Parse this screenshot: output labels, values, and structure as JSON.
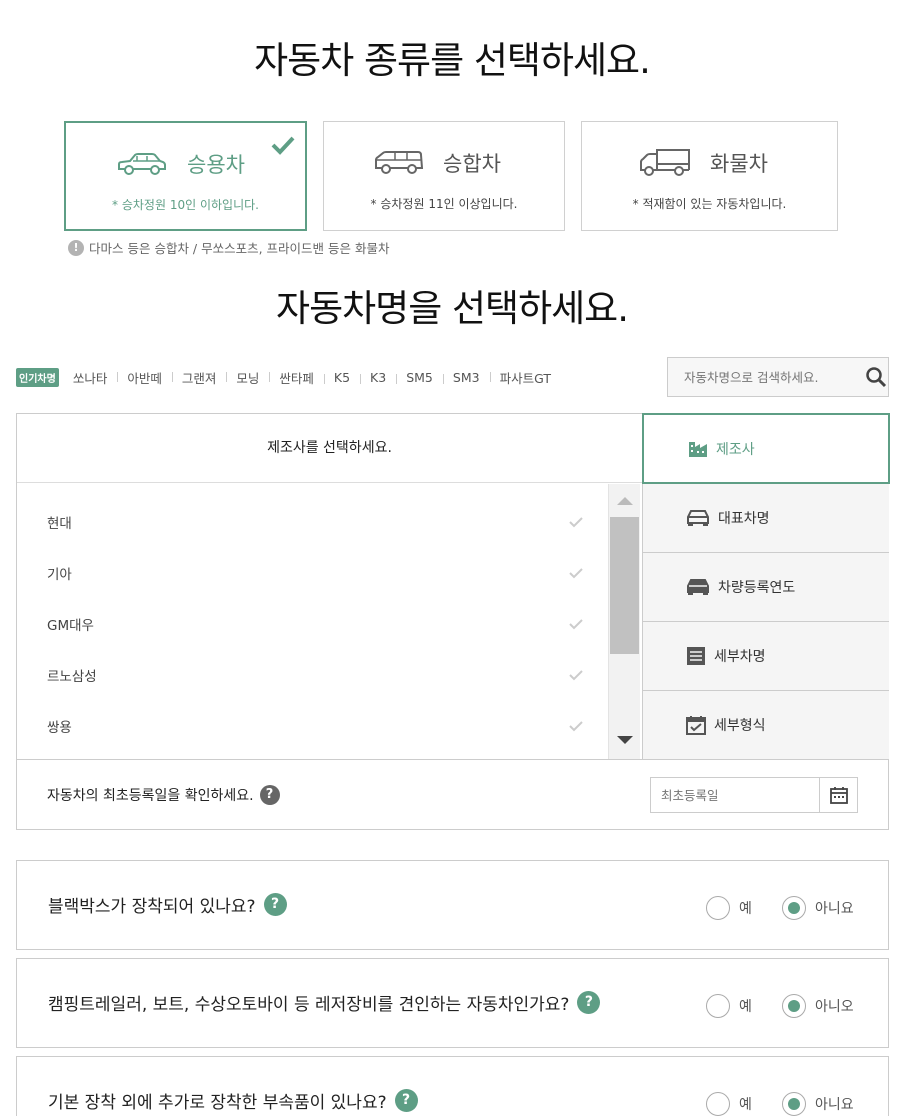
{
  "vehicle_type_title": "자동차 종류를 선택하세요.",
  "vehicle_types": [
    {
      "name": "승용차",
      "desc": "* 승차정원 10인 이하입니다.",
      "selected": true
    },
    {
      "name": "승합차",
      "desc": "* 승차정원 11인 이상입니다.",
      "selected": false
    },
    {
      "name": "화물차",
      "desc": "* 적재함이 있는 자동차입니다.",
      "selected": false
    }
  ],
  "type_notice": "다마스 등은 승합차 / 무쏘스포츠, 프라이드밴 등은 화물차",
  "car_name_title": "자동차명을 선택하세요.",
  "popular": {
    "badge": "인기차명",
    "items": [
      "쏘나타",
      "아반떼",
      "그랜져",
      "모닝",
      "싼타페",
      "K5",
      "K3",
      "SM5",
      "SM3",
      "파사트GT"
    ]
  },
  "search": {
    "placeholder": "자동차명으로 검색하세요."
  },
  "maker_panel": {
    "header": "제조사를 선택하세요.",
    "makers": [
      "현대",
      "기아",
      "GM대우",
      "르노삼성",
      "쌍용"
    ]
  },
  "tabs": [
    {
      "label": "제조사",
      "icon": "building-icon",
      "active": true
    },
    {
      "label": "대표차명",
      "icon": "car-icon",
      "active": false
    },
    {
      "label": "차량등록연도",
      "icon": "car-icon",
      "active": false
    },
    {
      "label": "세부차명",
      "icon": "list-icon",
      "active": false
    },
    {
      "label": "세부형식",
      "icon": "calendar-check-icon",
      "active": false
    }
  ],
  "first_registration": {
    "label": "자동차의 최초등록일을 확인하세요.",
    "help": "?",
    "placeholder": "최초등록일"
  },
  "questions": [
    {
      "text": "블랙박스가 장착되어 있나요?",
      "help": "?",
      "yes": "예",
      "no": "아니요",
      "selected": "no"
    },
    {
      "text": "캠핑트레일러, 보트, 수상오토바이 등 레저장비를 견인하는 자동차인가요?",
      "help": "?",
      "yes": "예",
      "no": "아니오",
      "selected": "no"
    },
    {
      "text": "기본 장착 외에 추가로 장착한 부속품이 있나요?",
      "help": "?",
      "yes": "예",
      "no": "아니요",
      "selected": "no"
    }
  ],
  "colors": {
    "accent": "#5e9e85",
    "border": "#cccccc",
    "tab_bg": "#f5f5f5"
  }
}
